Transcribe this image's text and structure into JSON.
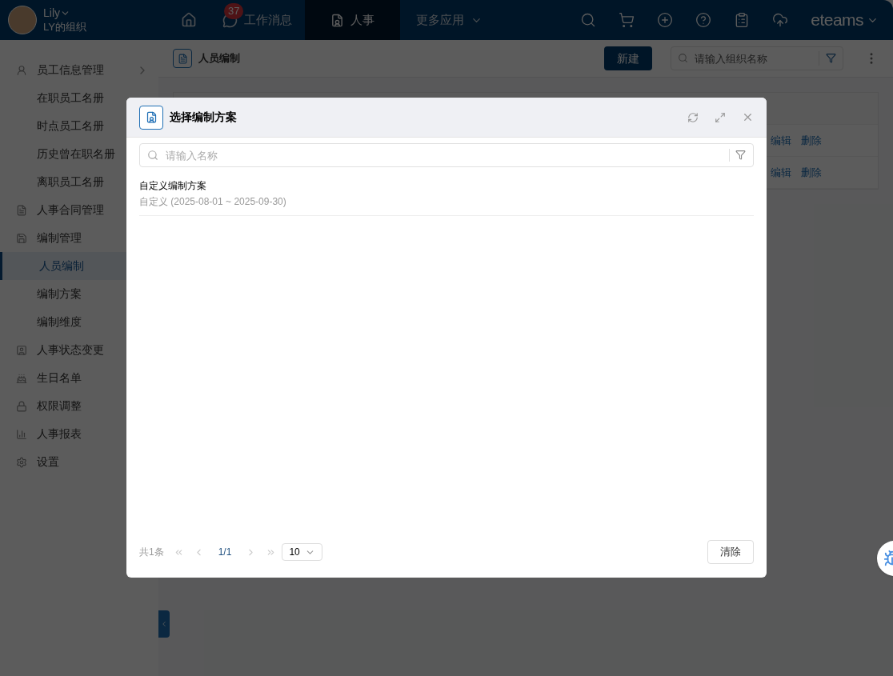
{
  "header": {
    "user": {
      "name": "Lily",
      "org": "LY的组织"
    },
    "nav": [
      {
        "kind": "home",
        "selected": false
      },
      {
        "kind": "messages",
        "label": "工作消息",
        "badge": "37",
        "selected": false
      },
      {
        "kind": "app",
        "label": "人事",
        "selected": true
      },
      {
        "kind": "more",
        "label": "更多应用",
        "selected": false
      }
    ],
    "brand": "eteams"
  },
  "sidebar": {
    "items": [
      {
        "label": "员工信息管理",
        "selected": false,
        "children": [
          {
            "label": "在职员工名册",
            "selected": false
          },
          {
            "label": "时点员工名册",
            "selected": false
          },
          {
            "label": "历史曾在职名册",
            "selected": false
          },
          {
            "label": "离职员工名册",
            "selected": false
          }
        ]
      },
      {
        "label": "人事合同管理",
        "selected": false
      },
      {
        "label": "编制管理",
        "selected": false,
        "children": [
          {
            "label": "人员编制",
            "selected": true
          },
          {
            "label": "编制方案",
            "selected": false
          },
          {
            "label": "编制维度",
            "selected": false
          }
        ]
      },
      {
        "label": "人事状态变更",
        "selected": false
      },
      {
        "label": "生日名单",
        "selected": false
      },
      {
        "label": "权限调整",
        "selected": false
      },
      {
        "label": "人事报表",
        "selected": false
      },
      {
        "label": "设置",
        "selected": false
      }
    ]
  },
  "page": {
    "title": "人员编制",
    "new_button": "新建",
    "search": {
      "placeholder": "请输入组织名称"
    },
    "rows": [
      {
        "actions": [
          "编辑",
          "删除"
        ]
      },
      {
        "actions": [
          "编辑",
          "删除"
        ]
      }
    ]
  },
  "modal": {
    "title": "选择编制方案",
    "search": {
      "placeholder": "请输入名称"
    },
    "items": [
      {
        "name": "自定义编制方案",
        "detail": "自定义 (2025-08-01 ~ 2025-09-30)"
      }
    ],
    "footer": {
      "total": "共1条",
      "page": "1/1",
      "page_size": "10",
      "clear": "清除"
    }
  }
}
